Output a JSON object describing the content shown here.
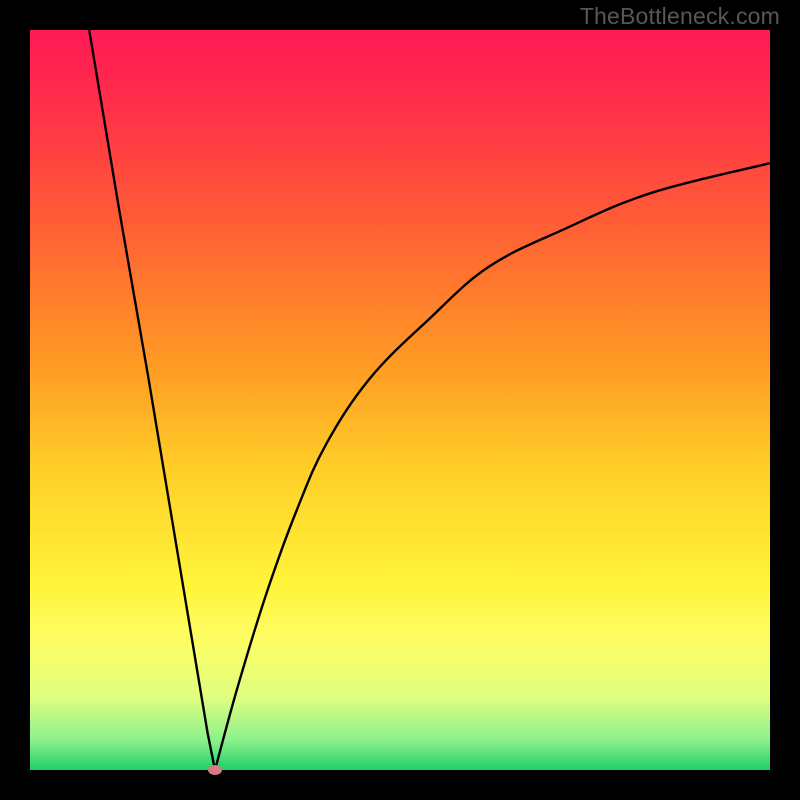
{
  "watermark": "TheBottleneck.com",
  "colors": {
    "frame": "#000000",
    "curve": "#000000",
    "marker": "#d97a81",
    "gradient_stops": [
      {
        "pct": 0,
        "color": "#ff1a55"
      },
      {
        "pct": 10,
        "color": "#ff2e4a"
      },
      {
        "pct": 25,
        "color": "#ff5a36"
      },
      {
        "pct": 45,
        "color": "#ff9a24"
      },
      {
        "pct": 60,
        "color": "#ffd028"
      },
      {
        "pct": 75,
        "color": "#fff43a"
      },
      {
        "pct": 82,
        "color": "#fffd62"
      },
      {
        "pct": 90,
        "color": "#e0ff80"
      },
      {
        "pct": 96,
        "color": "#8cf08c"
      },
      {
        "pct": 100,
        "color": "#1fcf6a"
      }
    ]
  },
  "chart_data": {
    "type": "line",
    "title": "",
    "xlabel": "",
    "ylabel": "",
    "xlim": [
      0,
      100
    ],
    "ylim": [
      0,
      100
    ],
    "min_point": {
      "x": 25,
      "y": 0
    },
    "note": "Left branch is a straight line from (8,100) to the minimum; right branch rises concave toward (100,~82). Values estimated from pixels; no explicit axis ticks are visible.",
    "series": [
      {
        "name": "left-branch",
        "x": [
          8,
          12,
          16,
          20,
          24,
          25
        ],
        "y": [
          100,
          76,
          53,
          29,
          5,
          0
        ]
      },
      {
        "name": "right-branch",
        "x": [
          25,
          28,
          32,
          36,
          40,
          46,
          54,
          62,
          72,
          84,
          100
        ],
        "y": [
          0,
          11,
          24,
          35,
          44,
          53,
          61,
          68,
          73,
          78,
          82
        ]
      }
    ]
  }
}
